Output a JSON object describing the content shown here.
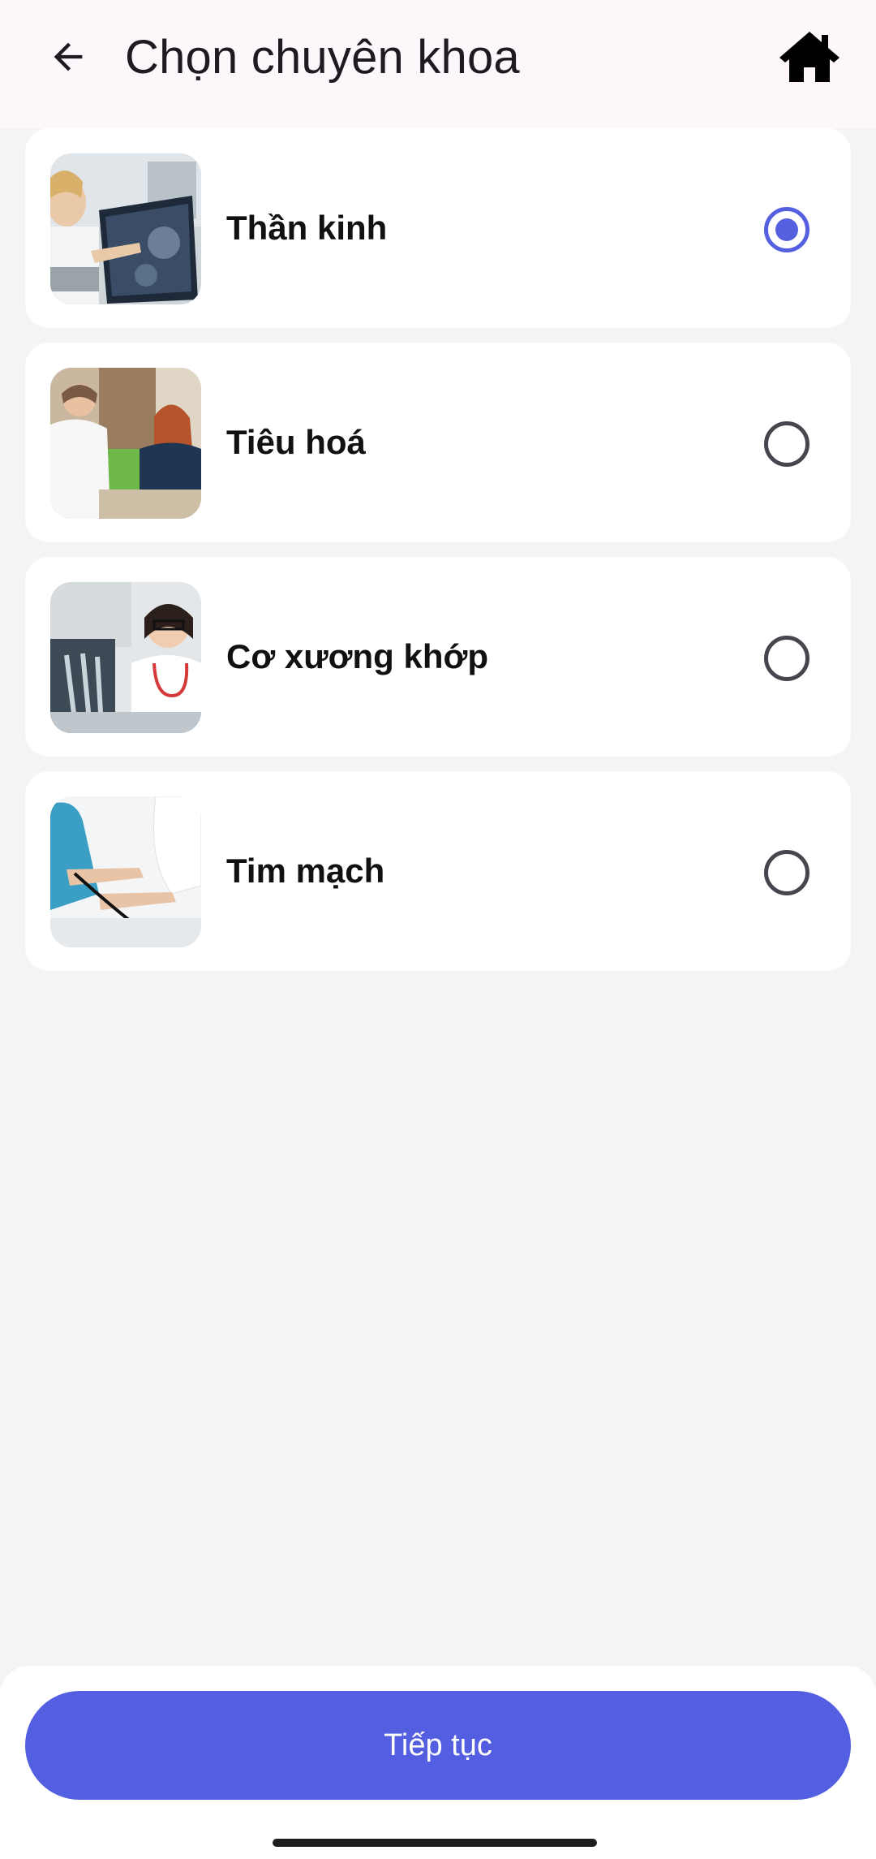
{
  "header": {
    "title": "Chọn chuyên khoa",
    "back_icon": "arrow-left-icon",
    "home_icon": "home-icon"
  },
  "specialties": [
    {
      "label": "Thần kinh",
      "selected": true,
      "image": "doctor-brain-scan-photo"
    },
    {
      "label": "Tiêu hoá",
      "selected": false,
      "image": "doctor-patient-consult-photo"
    },
    {
      "label": "Cơ xương khớp",
      "selected": false,
      "image": "doctor-xray-photo"
    },
    {
      "label": "Tim mạch",
      "selected": false,
      "image": "blood-pressure-photo"
    }
  ],
  "footer": {
    "continue_label": "Tiếp tục"
  },
  "colors": {
    "accent": "#535fe0",
    "header_bg": "#fdf7fb",
    "page_bg": "#f4f4f4"
  }
}
